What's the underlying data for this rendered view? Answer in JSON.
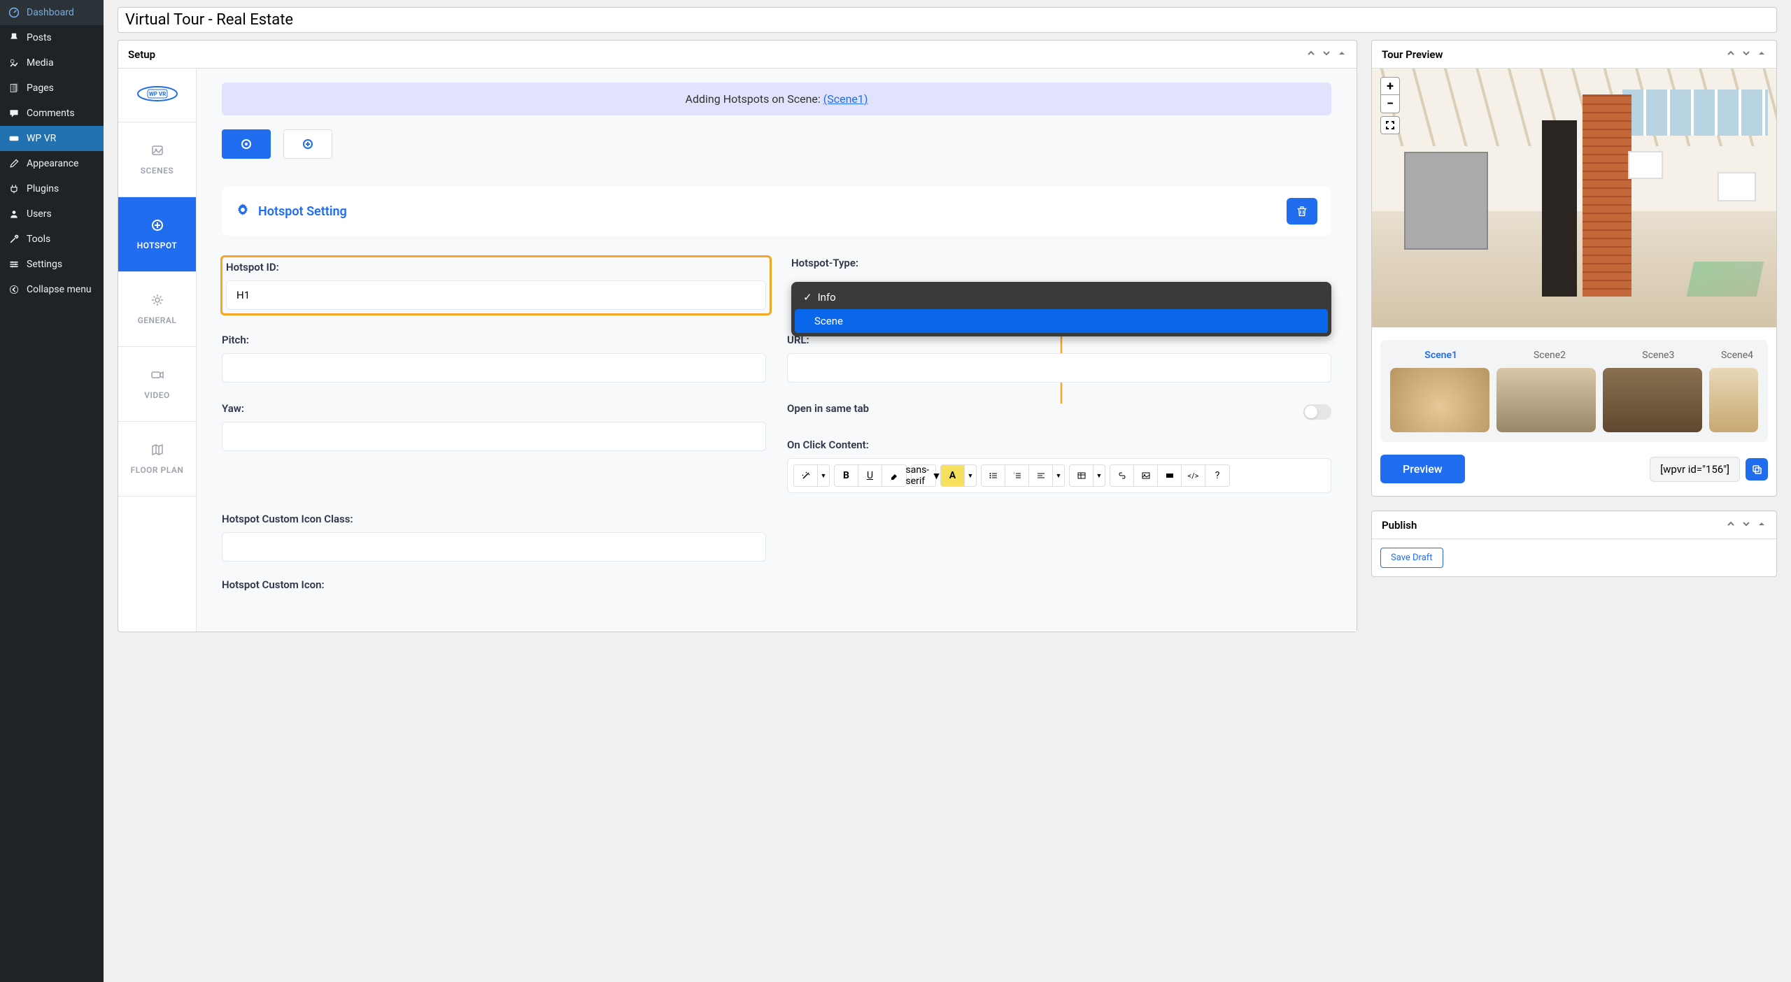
{
  "sidebar": {
    "items": [
      {
        "icon": "dashboard",
        "label": "Dashboard"
      },
      {
        "icon": "pin",
        "label": "Posts"
      },
      {
        "icon": "media",
        "label": "Media"
      },
      {
        "icon": "page",
        "label": "Pages"
      },
      {
        "icon": "comment",
        "label": "Comments"
      },
      {
        "icon": "vr",
        "label": "WP VR",
        "active": true
      },
      {
        "icon": "brush",
        "label": "Appearance"
      },
      {
        "icon": "plug",
        "label": "Plugins"
      },
      {
        "icon": "user",
        "label": "Users"
      },
      {
        "icon": "wrench",
        "label": "Tools"
      },
      {
        "icon": "gear",
        "label": "Settings"
      },
      {
        "icon": "collapse",
        "label": "Collapse menu"
      }
    ]
  },
  "page_title": "Virtual Tour - Real Estate",
  "setup": {
    "panel_title": "Setup",
    "logo_text": "WP VR",
    "tabs": [
      {
        "label": "SCENES"
      },
      {
        "label": "HOTSPOT",
        "active": true
      },
      {
        "label": "GENERAL"
      },
      {
        "label": "VIDEO"
      },
      {
        "label": "FLOOR PLAN"
      }
    ],
    "banner_text": "Adding Hotspots on Scene:",
    "banner_link": "(Scene1)",
    "hotspot_setting_title": "Hotspot Setting",
    "fields": {
      "hotspot_id_label": "Hotspot ID:",
      "hotspot_id_value": "H1",
      "hotspot_type_label": "Hotspot-Type:",
      "hotspot_type_options": [
        "Info",
        "Scene"
      ],
      "pitch_label": "Pitch:",
      "pitch_value": "",
      "url_label": "URL:",
      "url_value": "",
      "yaw_label": "Yaw:",
      "yaw_value": "",
      "open_same_tab_label": "Open in same tab",
      "on_click_label": "On Click Content:",
      "custom_icon_class_label": "Hotspot Custom Icon Class:",
      "custom_icon_class_value": "",
      "custom_icon_label": "Hotspot Custom Icon:",
      "editor_font": "sans-serif"
    }
  },
  "preview": {
    "panel_title": "Tour Preview",
    "scenes": [
      "Scene1",
      "Scene2",
      "Scene3",
      "Scene4"
    ],
    "preview_btn": "Preview",
    "shortcode": "[wpvr id=\"156\"]"
  },
  "publish": {
    "panel_title": "Publish",
    "save_draft": "Save Draft"
  }
}
